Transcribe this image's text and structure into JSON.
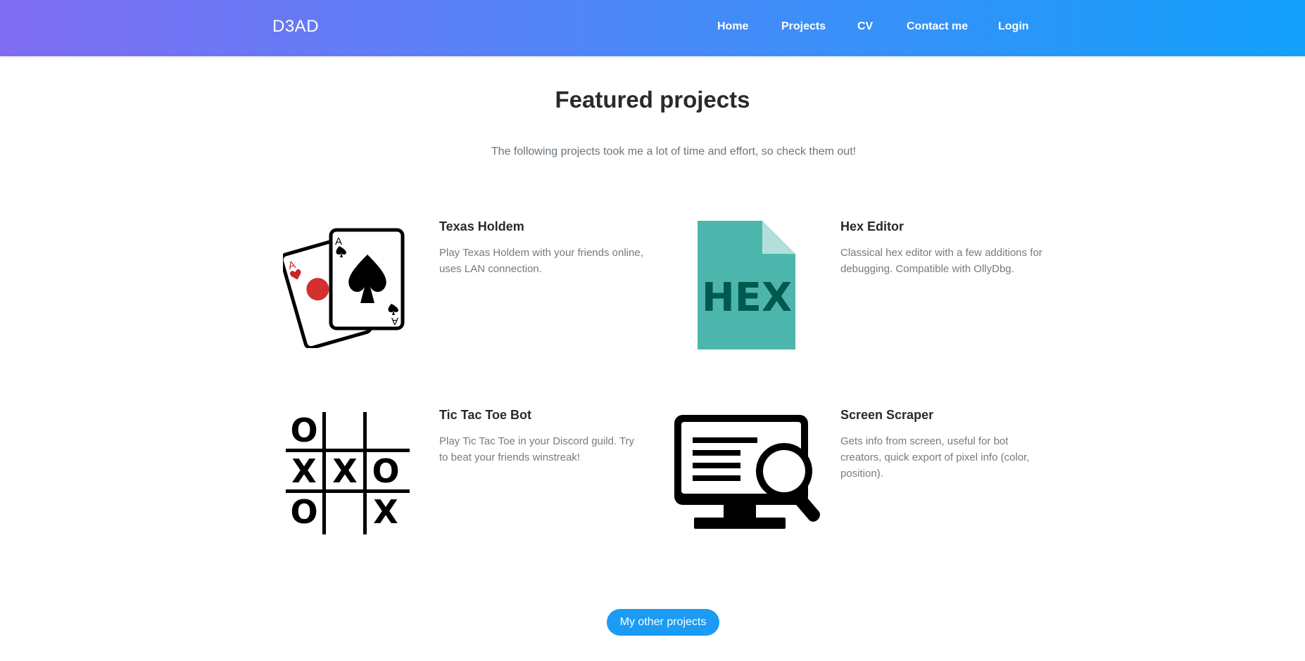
{
  "navbar": {
    "brand": "D3AD",
    "links": [
      "Home",
      "Projects",
      "CV",
      "Contact me",
      "Login"
    ]
  },
  "main": {
    "title": "Featured projects",
    "subtitle": "The following projects took me a lot of time and effort, so check them out!",
    "projects": [
      {
        "icon": "playing-cards-icon",
        "title": "Texas Holdem",
        "description": "Play Texas Holdem with your friends online, uses LAN connection."
      },
      {
        "icon": "hex-file-icon",
        "title": "Hex Editor",
        "description": "Classical hex editor with a few additions for debugging. Compatible with OllyDbg."
      },
      {
        "icon": "tic-tac-toe-icon",
        "title": "Tic Tac Toe Bot",
        "description": "Play Tic Tac Toe in your Discord guild. Try to beat your friends winstreak!"
      },
      {
        "icon": "screen-search-icon",
        "title": "Screen Scraper",
        "description": "Gets info from screen, useful for bot creators, quick export of pixel info (color, position)."
      }
    ],
    "other_projects_button": "My other projects"
  },
  "hex_icon_text": "HEX",
  "cards": {
    "rank": "A"
  },
  "tictactoe": [
    "O",
    "X",
    "X",
    "O",
    "O",
    "X"
  ],
  "colors": {
    "nav_start": "#7f6cf2",
    "nav_end": "#12a0fb",
    "button": "#1c9bf5",
    "hex_file": "#4db6ac",
    "hex_text": "#00594f"
  }
}
